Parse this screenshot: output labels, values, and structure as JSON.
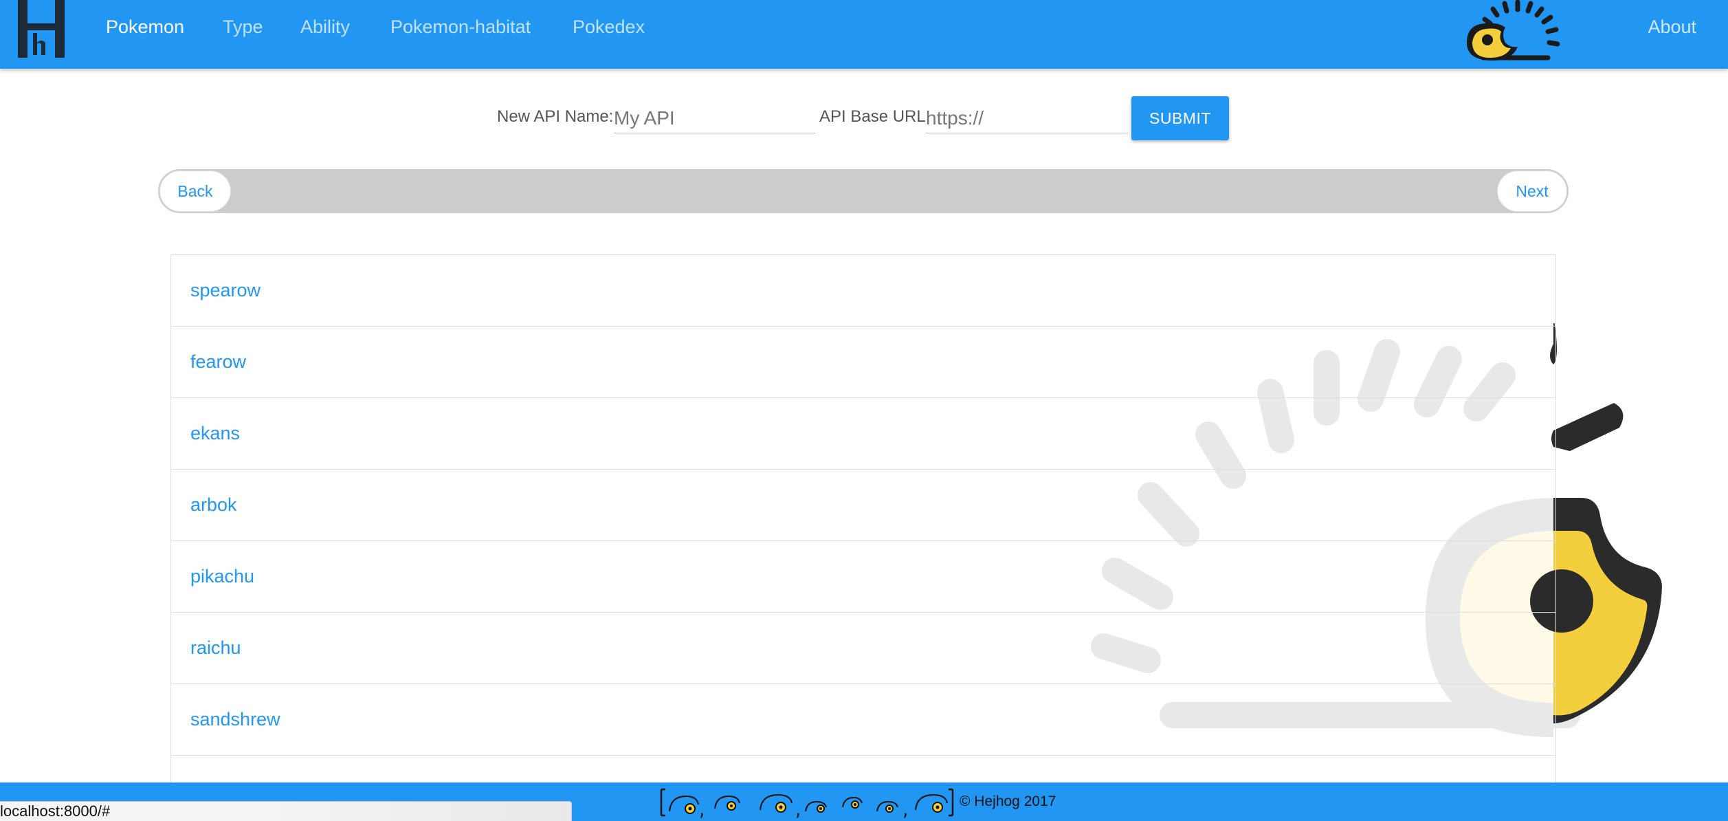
{
  "navbar": {
    "items": [
      {
        "label": "Pokemon",
        "active": true
      },
      {
        "label": "Type",
        "active": false
      },
      {
        "label": "Ability",
        "active": false
      },
      {
        "label": "Pokemon-habitat",
        "active": false
      },
      {
        "label": "Pokedex",
        "active": false
      }
    ],
    "about_label": "About",
    "brand_icon": "hejhog-h-logo-icon",
    "mascot_icon": "hedgehog-logo-icon",
    "accent_color": "#2196f3"
  },
  "api_form": {
    "name_label": "New API Name:",
    "name_placeholder": "My API",
    "url_label": "API Base URL:",
    "url_placeholder": "https://",
    "submit_label": "SUBMIT"
  },
  "pager": {
    "back_label": "Back",
    "next_label": "Next"
  },
  "pokemon_list": [
    "spearow",
    "fearow",
    "ekans",
    "arbok",
    "pikachu",
    "raichu",
    "sandshrew"
  ],
  "footer": {
    "copyright": "© Hejhog 2017",
    "icon": "hedgehog-sequence-icon"
  },
  "statusbar": {
    "url": "localhost:8000/#"
  }
}
